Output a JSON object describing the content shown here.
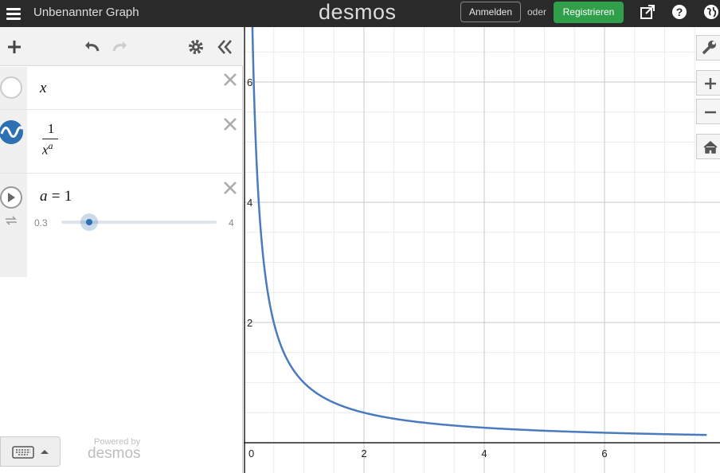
{
  "app": {
    "title": "Unbenannter Graph",
    "brand": "desmos",
    "login_label": "Anmelden",
    "or_text": "oder",
    "signup_label": "Registrieren"
  },
  "expressions": [
    {
      "text": "x",
      "color": "#cccccc",
      "icon": "empty-circle-icon"
    },
    {
      "numerator": "1",
      "denominator_base": "x",
      "denominator_exp": "a",
      "color": "#2d70b3",
      "icon": "wave-icon"
    },
    {
      "lhs": "a",
      "eq": "=",
      "rhs": "1",
      "slider_min": "0.3",
      "slider_max": "4",
      "slider_value": 1,
      "icon": "play-icon"
    }
  ],
  "footer": {
    "powered_by": "Powered by",
    "logo": "desmos"
  },
  "graph": {
    "x_ticks": [
      "0",
      "2",
      "4",
      "6"
    ],
    "y_ticks": [
      "2",
      "4",
      "6"
    ],
    "curve_color": "#4a7bbf"
  },
  "chart_data": {
    "type": "line",
    "series": [
      {
        "expression": "1/x^a",
        "a": 1
      }
    ],
    "xlim": [
      0,
      7.7
    ],
    "ylim": [
      0,
      7
    ],
    "grid": true
  }
}
